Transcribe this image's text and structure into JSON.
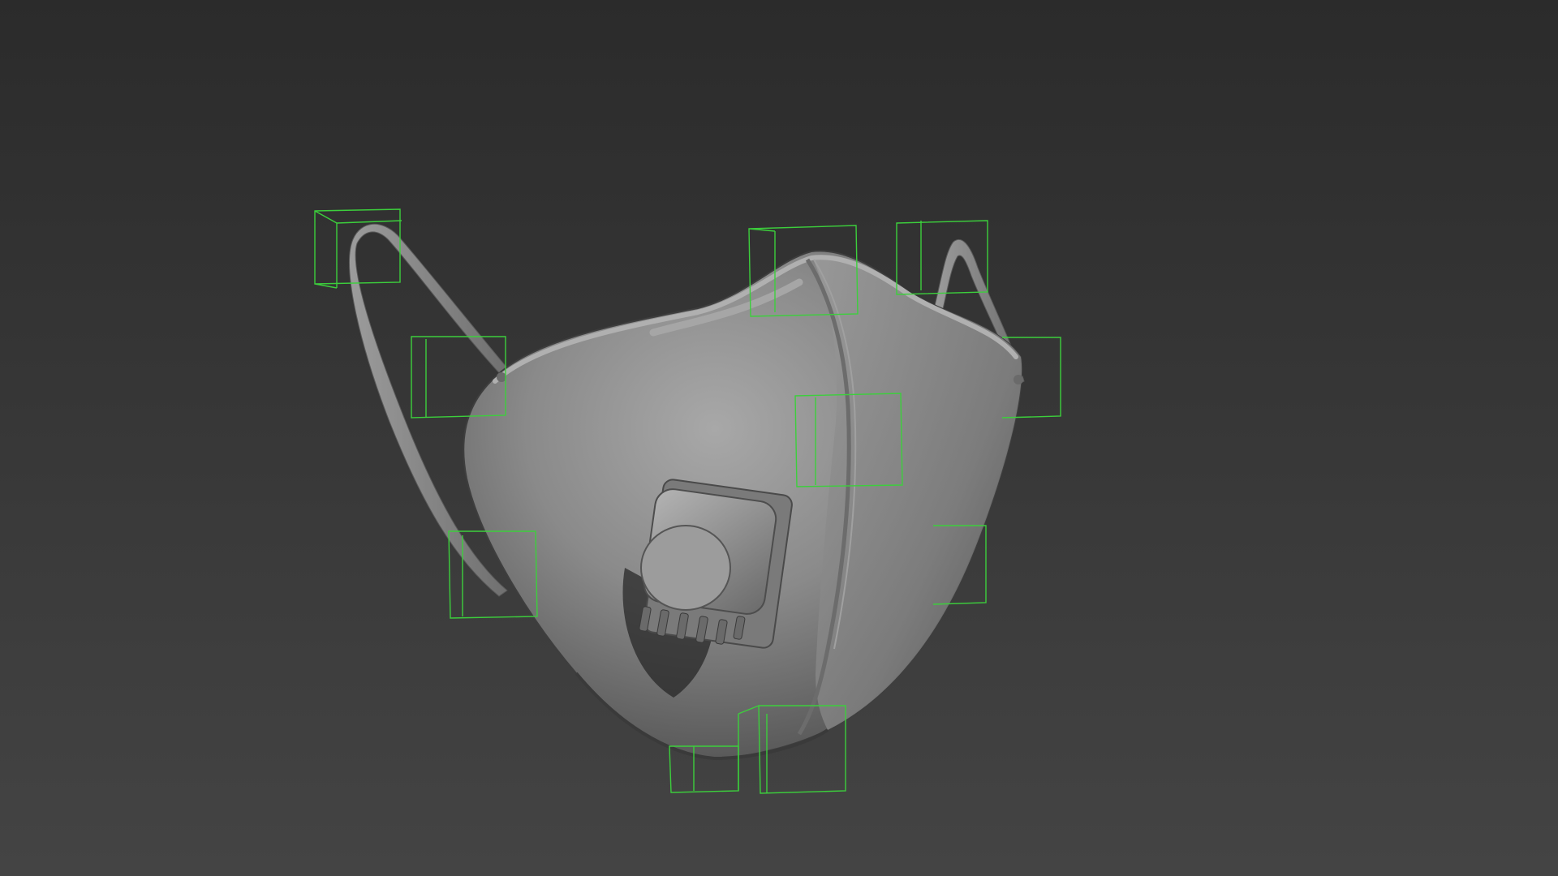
{
  "viewport": {
    "kind": "3d-perspective-viewport",
    "background_top": "#2b2b2b",
    "background_bottom": "#444444"
  },
  "model": {
    "object": "respirator-mask-with-exhalation-valve",
    "shading": "clay-grey",
    "color": "#8a8a8a"
  },
  "selection": {
    "bounding_box_color": "#3ccf3c",
    "selected_count": 12
  }
}
